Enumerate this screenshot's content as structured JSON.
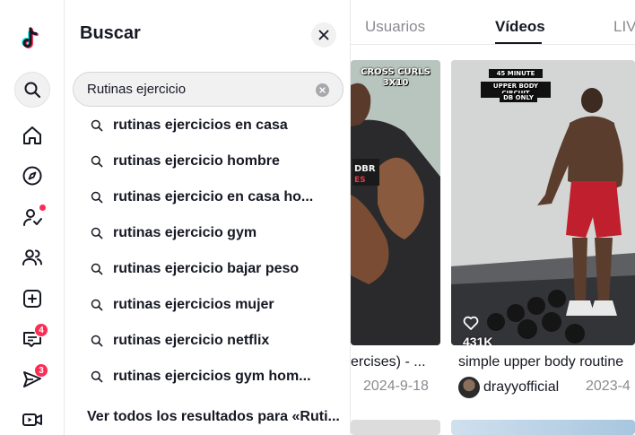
{
  "rail": {
    "logo_icon": "tiktok-logo",
    "items": [
      {
        "name": "search-icon"
      },
      {
        "name": "home-icon"
      },
      {
        "name": "explore-icon"
      },
      {
        "name": "following-icon"
      },
      {
        "name": "friends-icon"
      },
      {
        "name": "upload-icon"
      },
      {
        "name": "activity-icon",
        "badge": "4"
      },
      {
        "name": "messages-icon",
        "badge": "3"
      },
      {
        "name": "live-icon"
      }
    ]
  },
  "search_panel": {
    "title": "Buscar",
    "query": "Rutinas ejercicio",
    "suggestions": [
      "rutinas ejercicios en casa",
      "rutinas ejercicio hombre",
      "rutinas ejercicio en casa ho...",
      "rutinas ejercicio gym",
      "rutinas ejercicio bajar peso",
      "rutinas ejercicios mujer",
      "rutinas ejercicio netflix",
      "rutinas ejercicios gym hom..."
    ],
    "see_all": "Ver todos los resultados para «Ruti..."
  },
  "tabs": [
    {
      "label": "Usuarios",
      "active": false
    },
    {
      "label": "Vídeos",
      "active": true
    },
    {
      "label": "LIV",
      "active": false
    }
  ],
  "videos": [
    {
      "overlay": [
        "CROSS CURLS",
        "3X10"
      ],
      "title": "ercises) - ...",
      "date": "2024-9-18"
    },
    {
      "overlay": [
        "45 MINUTE",
        "UPPER BODY CIRCUIT",
        "DB ONLY"
      ],
      "likes": "431K",
      "title": "simple upper body routine",
      "author": "drayyofficial",
      "date": "2023-4"
    }
  ],
  "colors": {
    "accent": "#fe2c55",
    "text": "#161823",
    "muted": "#8a8b91"
  }
}
